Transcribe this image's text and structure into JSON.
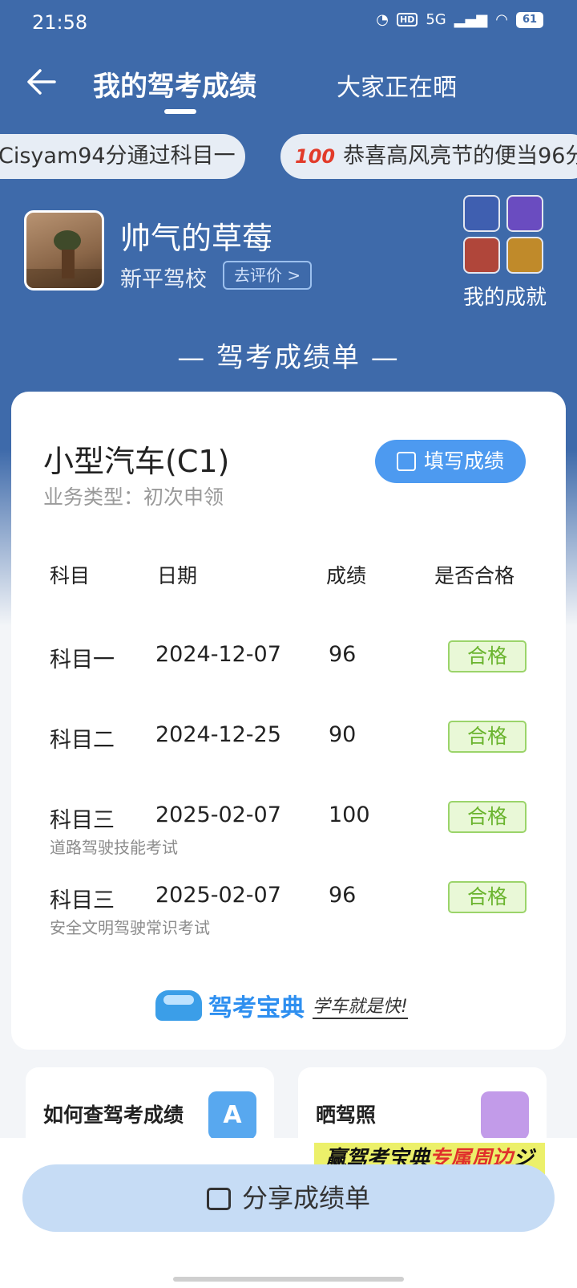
{
  "status_bar": {
    "time": "21:58",
    "network": "5G",
    "hd": "HD",
    "battery": "61"
  },
  "nav": {
    "tab_active": "我的驾考成绩",
    "tab_other": "大家正在晒"
  },
  "tickers": [
    {
      "text": "Cisyam94分通过科目一"
    },
    {
      "emoji": "💯",
      "text": "恭喜高风亮节的便当96分"
    }
  ],
  "profile": {
    "name": "帅气的草莓",
    "school": "新平驾校",
    "review_label": "去评价 >",
    "achievement_label": "我的成就"
  },
  "sheet_title": "— 驾考成绩单 —",
  "card": {
    "car_type": "小型汽车(C1)",
    "business_type": "业务类型：初次申领",
    "fill_button": "填写成绩",
    "headers": {
      "subject": "科目",
      "date": "日期",
      "score": "成绩",
      "pass": "是否合格"
    },
    "rows": [
      {
        "subject": "科目一",
        "date": "2024-12-07",
        "score": "96",
        "status": "合格",
        "note": ""
      },
      {
        "subject": "科目二",
        "date": "2024-12-25",
        "score": "90",
        "status": "合格",
        "note": ""
      },
      {
        "subject": "科目三",
        "date": "2025-02-07",
        "score": "100",
        "status": "合格",
        "note": "道路驾驶技能考试"
      },
      {
        "subject": "科目三",
        "date": "2025-02-07",
        "score": "96",
        "status": "合格",
        "note": "安全文明驾驶常识考试"
      }
    ],
    "brand_name": "驾考宝典",
    "brand_slogan": "学车就是快!"
  },
  "info_cards": {
    "query": "如何查驾考成绩",
    "license": "晒驾照"
  },
  "promo": {
    "prefix": "赢驾考宝典",
    "highlight": "专属周边",
    "suffix": "ジ"
  },
  "share_button": "分享成绩单"
}
